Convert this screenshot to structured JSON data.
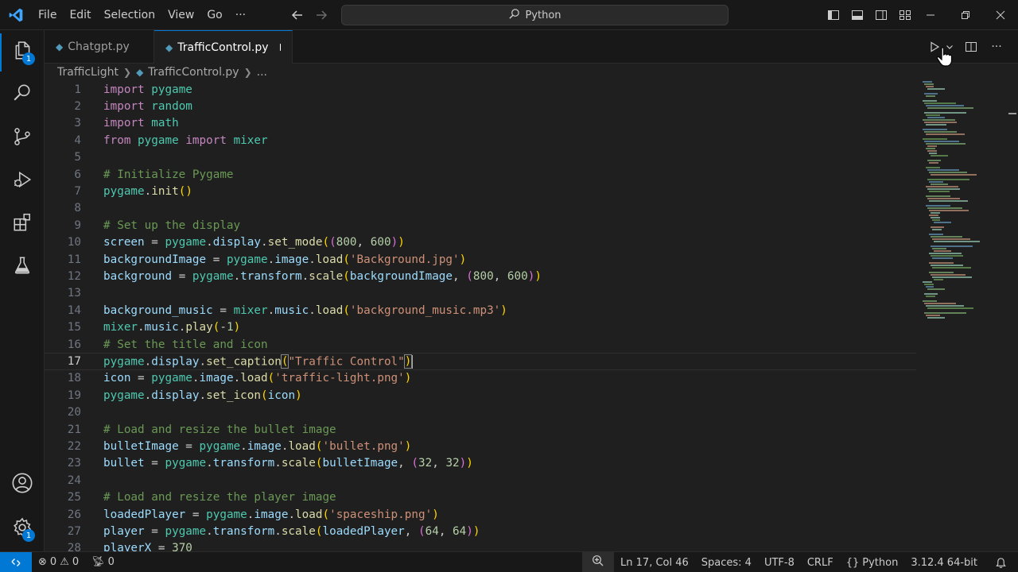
{
  "titlebar": {
    "menu": [
      "File",
      "Edit",
      "Selection",
      "View",
      "Go",
      "···"
    ],
    "search_text": "Python",
    "icons": [
      "vscode-logo",
      "arrow-left-icon",
      "arrow-right-icon",
      "search-icon",
      "toggle-sidebar-icon",
      "toggle-panel-icon",
      "toggle-secondary-sidebar-icon",
      "customize-layout-icon",
      "minimize-icon",
      "restore-icon",
      "close-icon"
    ]
  },
  "activitybar": {
    "explorer_badge": "1",
    "settings_badge": "1",
    "icons": [
      "explorer-icon",
      "search-icon",
      "source-control-icon",
      "run-debug-icon",
      "extensions-icon",
      "testing-icon",
      "account-icon",
      "manage-gear-icon"
    ]
  },
  "tabs": [
    {
      "label": "Chatgpt.py",
      "active": false
    },
    {
      "label": "TrafficControl.py",
      "active": true,
      "dirty": true
    }
  ],
  "breadcrumb": {
    "folder": "TrafficLight",
    "file": "TrafficControl.py",
    "more": "..."
  },
  "editor": {
    "current_line": 17,
    "lines": [
      {
        "n": "1",
        "t": "import pygame"
      },
      {
        "n": "2",
        "t": "import random"
      },
      {
        "n": "3",
        "t": "import math"
      },
      {
        "n": "4",
        "t": "from pygame import mixer"
      },
      {
        "n": "5",
        "t": ""
      },
      {
        "n": "6",
        "t": "# Initialize Pygame"
      },
      {
        "n": "7",
        "t": "pygame.init()"
      },
      {
        "n": "8",
        "t": ""
      },
      {
        "n": "9",
        "t": "# Set up the display"
      },
      {
        "n": "10",
        "t": "screen = pygame.display.set_mode((800, 600))"
      },
      {
        "n": "11",
        "t": "backgroundImage = pygame.image.load('Background.jpg')"
      },
      {
        "n": "12",
        "t": "background = pygame.transform.scale(backgroundImage, (800, 600))"
      },
      {
        "n": "13",
        "t": ""
      },
      {
        "n": "14",
        "t": "background_music = mixer.music.load('background_music.mp3')"
      },
      {
        "n": "15",
        "t": "mixer.music.play(-1)"
      },
      {
        "n": "16",
        "t": "# Set the title and icon"
      },
      {
        "n": "17",
        "t": "pygame.display.set_caption(\"Traffic Control\")"
      },
      {
        "n": "18",
        "t": "icon = pygame.image.load('traffic-light.png')"
      },
      {
        "n": "19",
        "t": "pygame.display.set_icon(icon)"
      },
      {
        "n": "20",
        "t": ""
      },
      {
        "n": "21",
        "t": "# Load and resize the bullet image"
      },
      {
        "n": "22",
        "t": "bulletImage = pygame.image.load('bullet.png')"
      },
      {
        "n": "23",
        "t": "bullet = pygame.transform.scale(bulletImage, (32, 32))"
      },
      {
        "n": "24",
        "t": ""
      },
      {
        "n": "25",
        "t": "# Load and resize the player image"
      },
      {
        "n": "26",
        "t": "loadedPlayer = pygame.image.load('spaceship.png')"
      },
      {
        "n": "27",
        "t": "player = pygame.transform.scale(loadedPlayer, (64, 64))"
      },
      {
        "n": "28",
        "t": "playerX = 370"
      }
    ]
  },
  "statusbar": {
    "errors": "0",
    "warnings": "0",
    "ports": "0",
    "position": "Ln 17, Col 46",
    "spaces": "Spaces: 4",
    "encoding": "UTF-8",
    "eol": "CRLF",
    "language": "Python",
    "interpreter": "3.12.4 64-bit"
  },
  "colors": {
    "accent": "#0078d4",
    "background": "#1f1f1f",
    "chrome": "#181818",
    "keyword": "#c586c0",
    "module": "#4ec9b0",
    "variable": "#9cdcfe",
    "function": "#dcdcaa",
    "string": "#ce9178",
    "number": "#b5cea8",
    "comment": "#6a9955"
  }
}
